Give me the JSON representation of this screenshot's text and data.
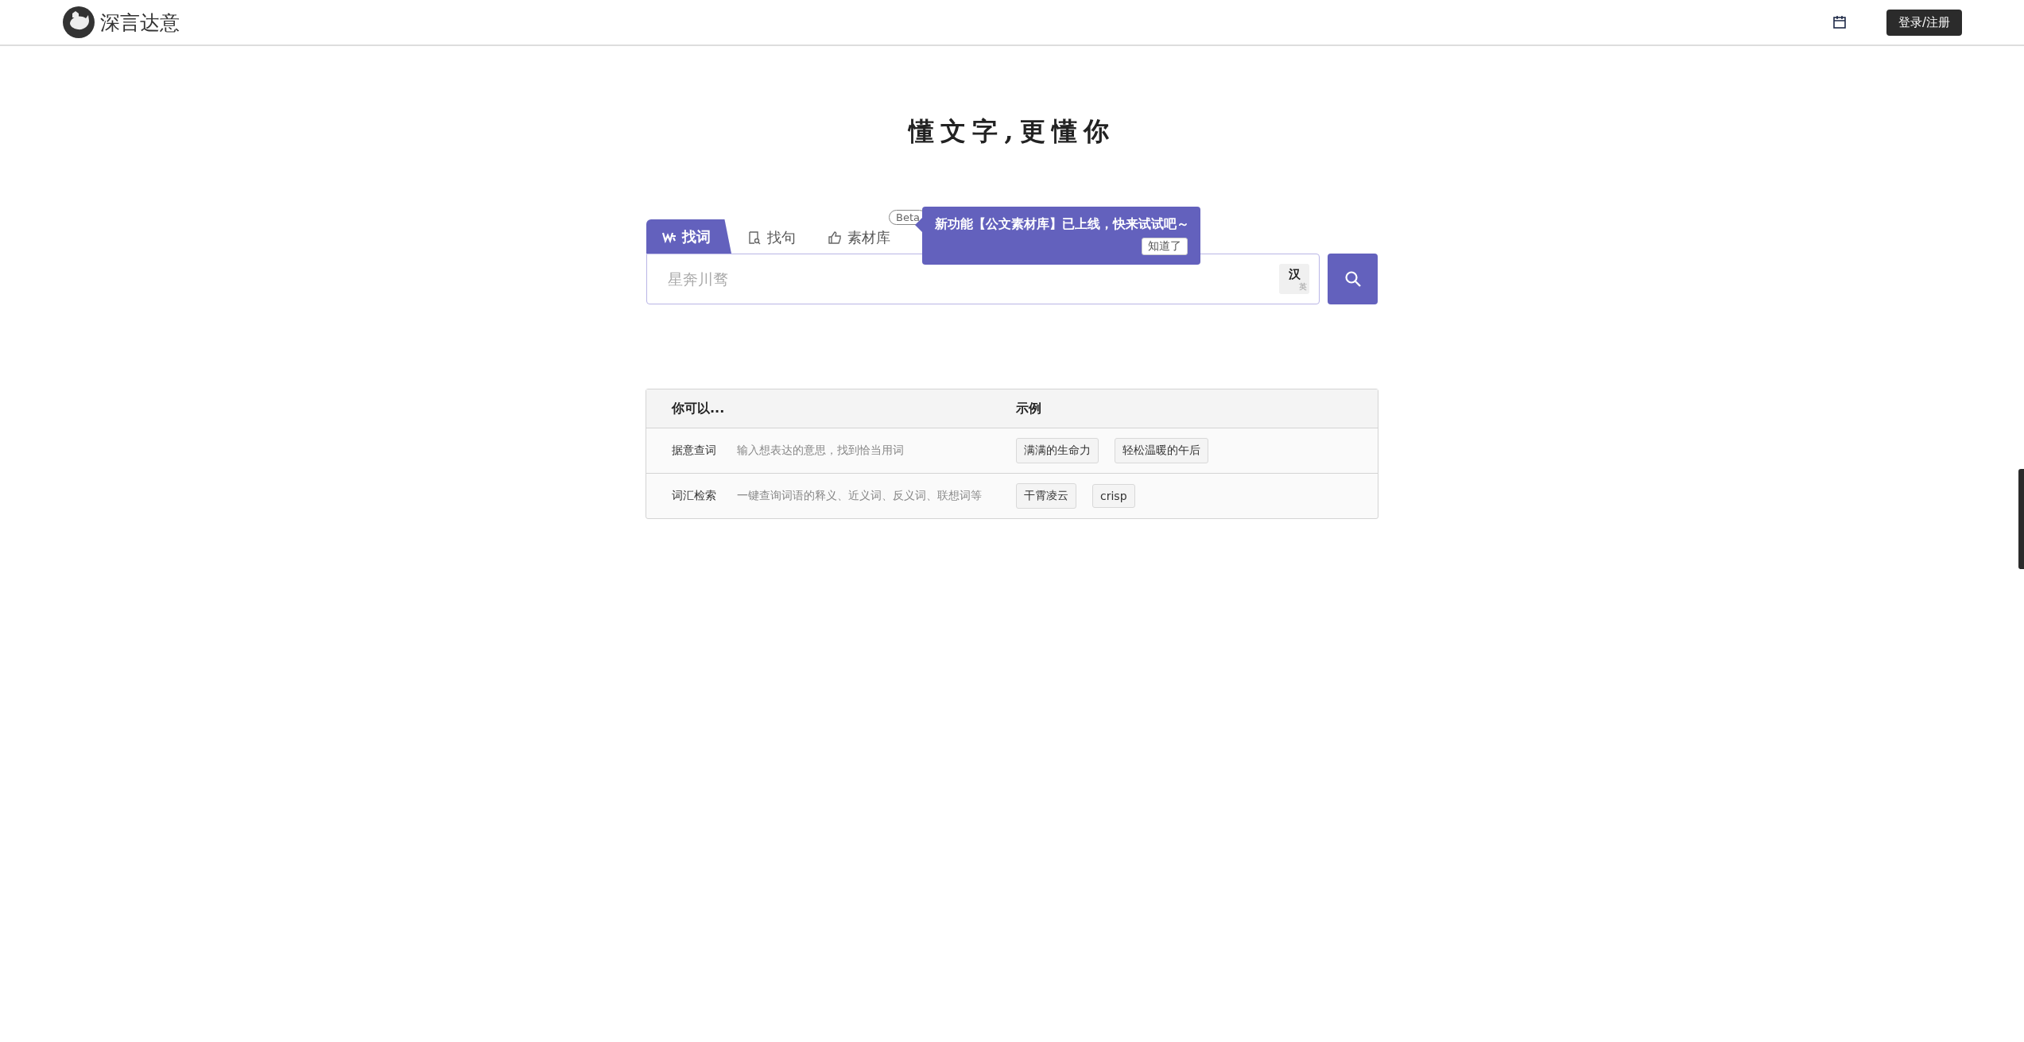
{
  "header": {
    "logo_text": "深言达意",
    "login_button": "登录/注册"
  },
  "slogan": "懂文字,更懂你",
  "tabs": [
    {
      "kind": "word",
      "label": "找词",
      "selected": true
    },
    {
      "kind": "sentence",
      "label": "找句",
      "selected": false
    },
    {
      "kind": "library",
      "label": "素材库",
      "selected": false,
      "badge": "Beta"
    }
  ],
  "tooltip": {
    "message": "新功能【公文素材库】已上线，快来试试吧～",
    "button": "知道了"
  },
  "search": {
    "placeholder": "星奔川骛",
    "lang_toggle": {
      "primary": "汉",
      "secondary": "英"
    }
  },
  "table": {
    "columns": [
      "你可以...",
      "示例"
    ],
    "rows": [
      {
        "name": "据意查词",
        "description": "输入想表达的意思，找到恰当用词",
        "examples": [
          "满满的生命力",
          "轻松温暖的午后"
        ]
      },
      {
        "name": "词汇检索",
        "description": "一键查询词语的释义、近义词、反义词、联想词等",
        "examples": [
          "干霄凌云",
          "crisp"
        ]
      }
    ]
  }
}
